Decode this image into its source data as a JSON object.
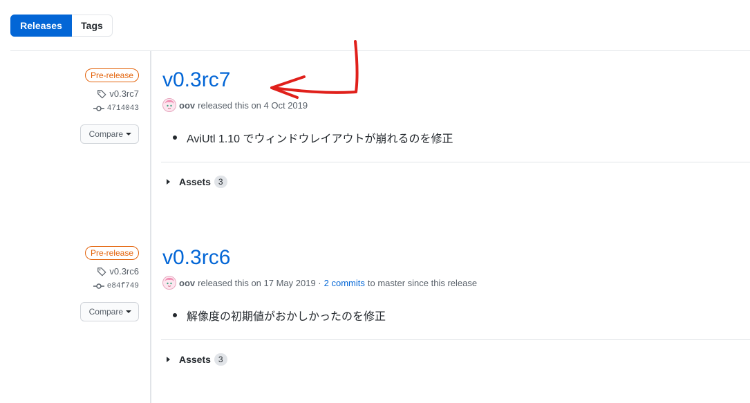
{
  "tabs": {
    "releases": "Releases",
    "tags": "Tags"
  },
  "releases": [
    {
      "badge": "Pre-release",
      "tag": "v0.3rc7",
      "commit": "4714043",
      "compare_label": "Compare",
      "title": "v0.3rc7",
      "author": "oov",
      "released_text": "released this on 4 Oct 2019",
      "commits_link": "",
      "commits_suffix": "",
      "note": "AviUtl 1.10 でウィンドウレイアウトが崩れるのを修正",
      "assets_label": "Assets",
      "assets_count": "3"
    },
    {
      "badge": "Pre-release",
      "tag": "v0.3rc6",
      "commit": "e84f749",
      "compare_label": "Compare",
      "title": "v0.3rc6",
      "author": "oov",
      "released_text": "released this on 17 May 2019 ·",
      "commits_link": "2 commits",
      "commits_suffix": "to master since this release",
      "note": "解像度の初期値がおかしかったのを修正",
      "assets_label": "Assets",
      "assets_count": "3"
    }
  ],
  "colors": {
    "accent": "#0366d6",
    "prerelease": "#e36209",
    "annotation_arrow": "#e0201b"
  }
}
